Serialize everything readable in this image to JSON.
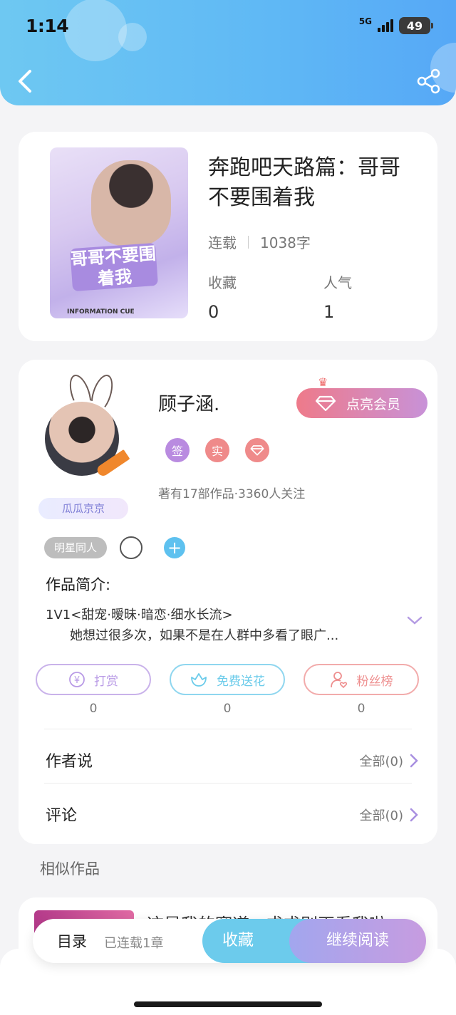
{
  "status": {
    "time": "1:14",
    "network": "5G",
    "battery": "49"
  },
  "book": {
    "title": "奔跑吧天路篇：哥哥不要围着我",
    "cover_art_text": "哥哥不要围着我",
    "cover_caption": "INFORMATION CUE",
    "status": "连载",
    "word_count": "1038字",
    "stats": [
      {
        "label": "收藏",
        "value": "0"
      },
      {
        "label": "人气",
        "value": "1"
      }
    ]
  },
  "author": {
    "name": "顾子涵.",
    "region": "瓜瓜京京",
    "vip_label": "点亮会员",
    "badges": [
      {
        "text": "签",
        "color": "#b98be0"
      },
      {
        "text": "实",
        "color": "#ef8a8a"
      },
      {
        "text": "",
        "color": "#ef8a8a"
      }
    ],
    "stats_text": "著有17部作品·3360人关注"
  },
  "tags": {
    "category": "明星同人"
  },
  "intro": {
    "label": "作品简介:",
    "line1": "1V1<甜宠·暧昧·暗恋·细水长流>",
    "line2": "她想过很多次，如果不是在人群中多看了眼广..."
  },
  "actions": [
    {
      "label": "打赏",
      "count": "0",
      "color": "#b99be6"
    },
    {
      "label": "免费送花",
      "count": "0",
      "color": "#6bcbea"
    },
    {
      "label": "粉丝榜",
      "count": "0",
      "color": "#ee8f8f"
    }
  ],
  "rows": [
    {
      "label": "作者说",
      "right": "全部(0)"
    },
    {
      "label": "评论",
      "right": "全部(0)"
    }
  ],
  "similar": {
    "label": "相似作品",
    "first_title": "这是我的赛道，求求别再看我啦"
  },
  "bottom_bar": {
    "toc": "目录",
    "toc_sub": "已连载1章",
    "favorite": "收藏",
    "continue": "继续阅读"
  },
  "colors": {
    "header": "#5fb8f5",
    "accent": "#9aa3ee",
    "vip": "#ee7a8a"
  }
}
